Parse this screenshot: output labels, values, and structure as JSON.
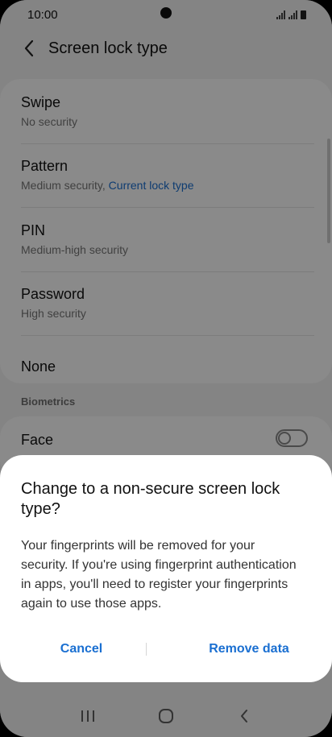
{
  "status_bar": {
    "time": "10:00"
  },
  "app_bar": {
    "title": "Screen lock type"
  },
  "lock_types": [
    {
      "title": "Swipe",
      "subtitle": "No security"
    },
    {
      "title": "Pattern",
      "subtitle": "Medium security,",
      "current_label": "Current lock type"
    },
    {
      "title": "PIN",
      "subtitle": "Medium-high security"
    },
    {
      "title": "Password",
      "subtitle": "High security"
    },
    {
      "title": "None"
    }
  ],
  "biometrics": {
    "section_label": "Biometrics",
    "items": [
      {
        "title": "Face",
        "enabled": false
      }
    ]
  },
  "dialog": {
    "title": "Change to a non-secure screen lock type?",
    "body": "Your fingerprints will be removed for your security. If you're using fingerprint authentication in apps, you'll need to register your fingerprints again to use those apps.",
    "cancel_label": "Cancel",
    "confirm_label": "Remove data"
  },
  "colors": {
    "accent": "#1a6fd1",
    "scrim": "rgba(0,0,0,0.46)"
  },
  "icons": {
    "back": "chevron-left-icon",
    "recents": "recents-icon",
    "home": "home-icon",
    "nav_back": "nav-back-icon"
  }
}
